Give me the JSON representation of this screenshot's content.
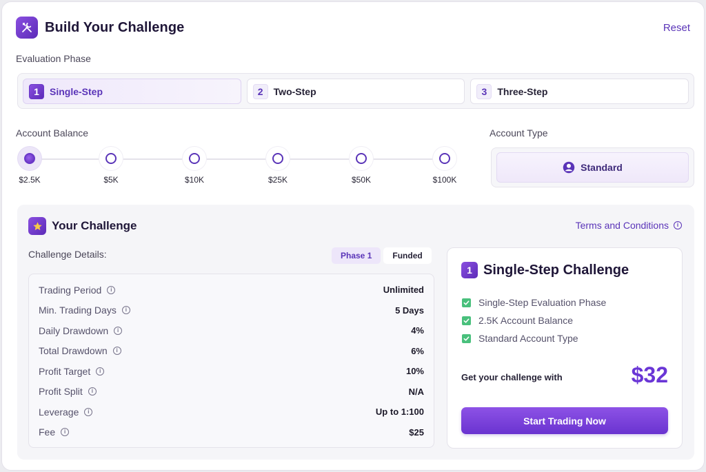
{
  "header": {
    "title": "Build Your Challenge",
    "reset_label": "Reset"
  },
  "evaluation": {
    "label": "Evaluation Phase",
    "phases": [
      {
        "num": "1",
        "label": "Single-Step",
        "active": true
      },
      {
        "num": "2",
        "label": "Two-Step",
        "active": false
      },
      {
        "num": "3",
        "label": "Three-Step",
        "active": false
      }
    ]
  },
  "balance": {
    "label": "Account Balance",
    "options": [
      "$2.5K",
      "$5K",
      "$10K",
      "$25K",
      "$50K",
      "$100K"
    ],
    "selected": "$2.5K"
  },
  "account_type": {
    "label": "Account Type",
    "selected": "Standard"
  },
  "challenge": {
    "title": "Your Challenge",
    "terms_label": "Terms and Conditions",
    "details_label": "Challenge Details:",
    "toggle": {
      "phase1": "Phase 1",
      "funded": "Funded",
      "active": "phase1"
    },
    "details": [
      {
        "key": "Trading Period",
        "value": "Unlimited"
      },
      {
        "key": "Min. Trading Days",
        "value": "5 Days"
      },
      {
        "key": "Daily Drawdown",
        "value": "4%"
      },
      {
        "key": "Total Drawdown",
        "value": "6%"
      },
      {
        "key": "Profit Target",
        "value": "10%"
      },
      {
        "key": "Profit Split",
        "value": "N/A"
      },
      {
        "key": "Leverage",
        "value": "Up to 1:100"
      },
      {
        "key": "Fee",
        "value": "$25"
      }
    ]
  },
  "summary": {
    "num": "1",
    "title": "Single-Step Challenge",
    "checks": [
      "Single-Step Evaluation Phase",
      "2.5K Account Balance",
      "Standard Account Type"
    ],
    "get_label": "Get your challenge with",
    "price": "$32",
    "cta_label": "Start Trading Now"
  },
  "colors": {
    "accent": "#5a34b8",
    "accent_light": "#8a4fe0",
    "check": "#49c07c",
    "price": "#6a36d6"
  },
  "icons": {
    "logo": "tools-icon",
    "challenge": "star-icon",
    "account": "user-circle-icon",
    "info": "info-icon",
    "check": "checkbox-checked-icon"
  }
}
